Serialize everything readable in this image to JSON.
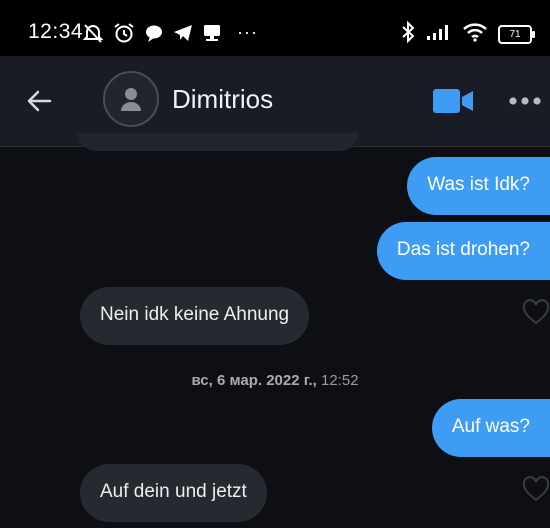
{
  "status_bar": {
    "time": "12:34",
    "battery": "71",
    "more": "···",
    "left_icons": [
      "mute-bell-icon",
      "alarm-icon",
      "chat-bubble-icon",
      "telegram-icon",
      "cast-icon"
    ],
    "right_icons": [
      "bluetooth-icon",
      "signal-icon",
      "wifi-icon",
      "battery-icon"
    ]
  },
  "header": {
    "contact_name": "Dimitrios",
    "accent_color": "#3e9cf5"
  },
  "messages": [
    {
      "direction": "out",
      "text": "Was ist Idk?"
    },
    {
      "direction": "out",
      "text": "Das ist drohen?"
    },
    {
      "direction": "in",
      "text": "Nein idk keine Ahnung"
    },
    {
      "type": "date",
      "date": "вс, 6 мар. 2022 г.,",
      "time": "12:52"
    },
    {
      "direction": "out",
      "text": "Auf was?"
    },
    {
      "direction": "in",
      "text": "Auf dein und jetzt"
    }
  ],
  "colors": {
    "background": "#0d0f14",
    "header_bg": "#191c24",
    "outgoing_bubble": "#3e9cf5",
    "incoming_bubble": "#262930"
  }
}
